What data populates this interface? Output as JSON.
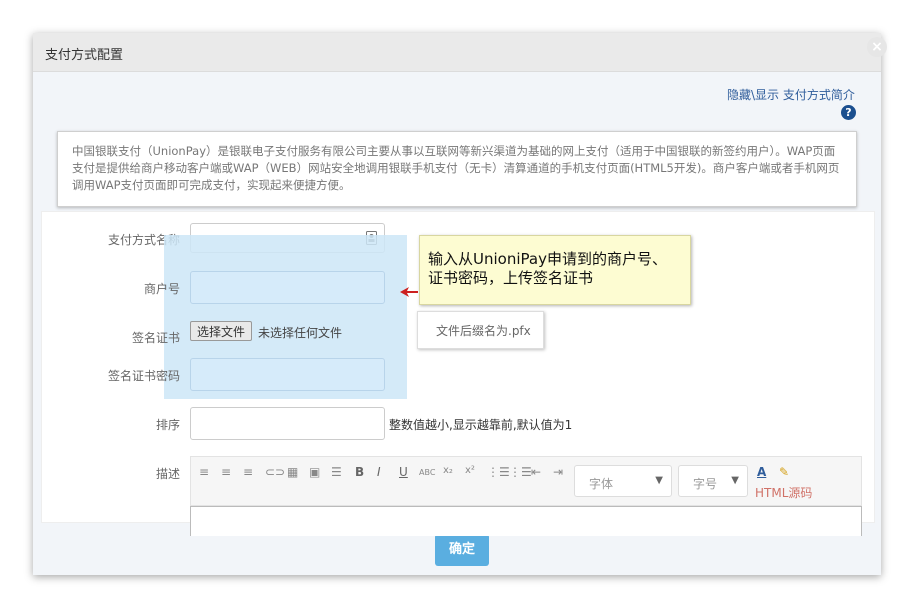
{
  "dialog": {
    "title": "支付方式配置",
    "close": "×"
  },
  "toplink": "隐藏\\显示 支付方式简介",
  "help": "?",
  "description": "中国银联支付（UnionPay）是银联电子支付服务有限公司主要从事以互联网等新兴渠道为基础的网上支付（适用于中国银联的新签约用户）。WAP页面支付是提供给商户移动客户端或WAP（WEB）网站安全地调用银联手机支付（无卡）清算通道的手机支付页面(HTML5开发)。商户客户端或者手机网页调用WAP支付页面即可完成支付，实现起来便捷方便。",
  "form": {
    "name_label": "支付方式名称",
    "name_value": "",
    "merchant_label": "商户号",
    "merchant_value": "",
    "cert_label": "签名证书",
    "file_button": "选择文件",
    "file_status": "未选择任何文件",
    "cert_pwd_label": "签名证书密码",
    "cert_pwd_value": "",
    "sort_label": "排序",
    "sort_value": "",
    "sort_hint": "整数值越小,显示越靠前,默认值为1",
    "desc_label": "描述"
  },
  "callout": "输入从UnioniPay申请到的商户号、证书密码，上传签名证书",
  "suffix_tip": "文件后缀名为.pfx",
  "editor": {
    "font_select": "字体",
    "size_select": "字号",
    "html_source": "HTML源码",
    "tool_icons": [
      "align-left-icon",
      "align-center-icon",
      "align-right-icon",
      "link-icon",
      "table-icon",
      "image-icon",
      "hr-icon",
      "bold-icon",
      "italic-icon",
      "underline-icon",
      "strikethrough-icon",
      "subscript-icon",
      "superscript-icon",
      "ordered-list-icon",
      "unordered-list-icon",
      "outdent-icon",
      "indent-icon"
    ]
  },
  "footer": {
    "ok_label": "确定"
  },
  "colors": {
    "accent": "#5aaee0",
    "callout_bg": "#fdfcd2",
    "highlight": "#cde6f7"
  }
}
